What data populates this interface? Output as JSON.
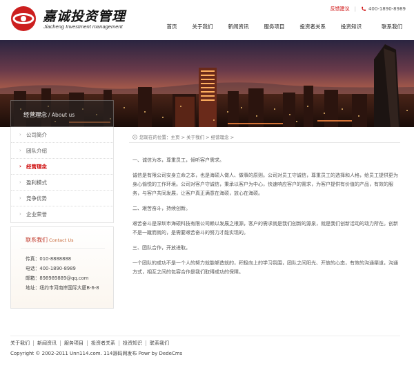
{
  "header": {
    "logo_title": "嘉诚投资管理",
    "logo_subtitle": "Jiacheng Investment management",
    "feedback_label": "反馈建议",
    "phone": "400-1890-8989"
  },
  "nav": [
    "首页",
    "关于我们",
    "新闻资讯",
    "服务项目",
    "投资者关系",
    "投资知识",
    "联系我们"
  ],
  "sidebar": {
    "heading": "经营理念",
    "heading_en": "/ About us",
    "items": [
      {
        "label": "公司简介",
        "active": false
      },
      {
        "label": "团队介绍",
        "active": false
      },
      {
        "label": "经营理念",
        "active": true
      },
      {
        "label": "盈利模式",
        "active": false
      },
      {
        "label": "竞争优势",
        "active": false
      },
      {
        "label": "企业荣誉",
        "active": false
      }
    ]
  },
  "contact": {
    "title": "联系我们",
    "title_en": "Contact Us",
    "fax": "传真：010-8888888",
    "tel": "电话：400-1890-8989",
    "email": "邮箱：898989889@qq.com",
    "address": "地址：纽约市河南岸国际大厦B-6-8"
  },
  "breadcrumb": {
    "text": "您现在的位置：主页 > 关于我们 > 经营理念 >"
  },
  "content": {
    "p1": "一、诚信为本，尊重员工，倾听客户需求。",
    "p2": "诚信是有限公司安身立命之本，也是海硕人做人、做事的原则。公司对员工守诚信，尊重员工的选择和人格，给员工提供更为身心愉悦的工作环境。公司对客户守诚信，秉承以客户为中心，快速响应客户的需求，为客户提供有价值的产品，有效的服务，与客户共同发展，让客户真正满意在海硕，放心在海硕。",
    "p3": "二、艰苦奋斗，持续创新。",
    "p4": "艰苦奋斗是深圳市海硕科技有限公司赖以发展之根源，客户的需求就是我们创新的源泉，就是我们创新活动的动力所在。创新不是一蹴而就的，是需要艰苦奋斗的努力才能实现的。",
    "p5": "三、团队合作，开放进取。",
    "p6": "一个团队的成功不是一个人的努力就能够造就的，积极向上的学习氛围，团队之间阳光、开放的心态，有效的沟通渠道，沟通方式，相互之间的包容合作是我们取得成功的保障。"
  },
  "footer": {
    "links": [
      "关于我们",
      "新闻资讯",
      "服务项目",
      "投资者关系",
      "投资知识",
      "联系我们"
    ],
    "copyright": "Copyright © 2002-2011 Unn114.com. 114源码网发布  Powr by DedeCms"
  },
  "colors": {
    "accent": "#c00000",
    "logo_red": "#cc1f1f"
  }
}
